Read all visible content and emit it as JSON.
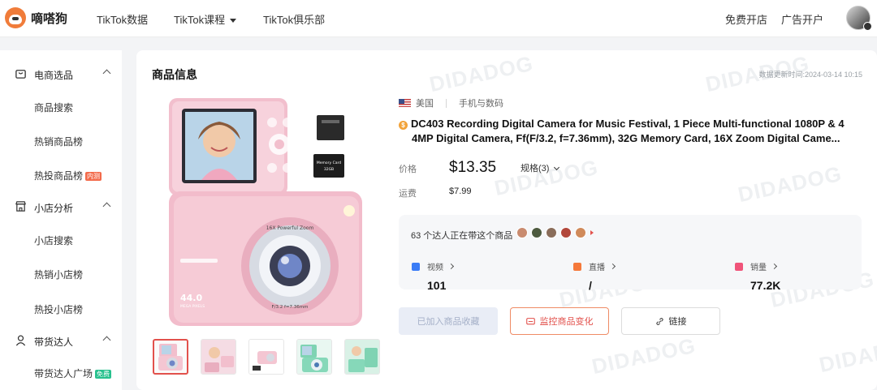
{
  "brand": {
    "name": "嘀嗒狗"
  },
  "nav": {
    "items": [
      "TikTok数据",
      "TikTok课程",
      "TikTok俱乐部"
    ],
    "right": [
      "免费开店",
      "广告开户"
    ]
  },
  "sidebar": {
    "groups": [
      {
        "label": "电商选品",
        "icon": "shopping-bag-icon",
        "items": [
          {
            "label": "商品搜索"
          },
          {
            "label": "热销商品榜"
          },
          {
            "label": "热投商品榜",
            "tag": "内测"
          }
        ]
      },
      {
        "label": "小店分析",
        "icon": "store-icon",
        "items": [
          {
            "label": "小店搜索"
          },
          {
            "label": "热销小店榜"
          },
          {
            "label": "热投小店榜"
          }
        ]
      },
      {
        "label": "带货达人",
        "icon": "person-icon",
        "items": [
          {
            "label": "带货达人广场",
            "tag": "免费"
          }
        ]
      }
    ]
  },
  "watermark": "DIDADOG",
  "product": {
    "section_title": "商品信息",
    "update_time": "数据更新时间:2024-03-14 10:15",
    "region": "美国",
    "category": "手机与数码",
    "title_line1": "DC403 Recording Digital Camera for Music Festival, 1 Piece Multi-functional 1080P & 4",
    "title_line2": "4MP Digital Camera, Ff(F/3.2, f=7.36mm), 32G Memory Card, 16X Zoom Digital Came...",
    "price_label": "价格",
    "price": "$13.35",
    "spec": "规格(3)",
    "shipping_label": "运费",
    "shipping": "$7.99",
    "camera_text": {
      "zoom": "16X Powerful Zoom",
      "mp": "44.0",
      "mp_sub": "MEGA PIXELS",
      "lens": "F/3.2  f=7.36mm",
      "card": "Memory Card",
      "card_size": "32GB"
    }
  },
  "stats": {
    "headline": "63 个达人正在带这个商品",
    "items": [
      {
        "label": "视频",
        "value": "101",
        "color": "#3a7cf6"
      },
      {
        "label": "直播",
        "value": "/",
        "color": "#f5793b"
      },
      {
        "label": "销量",
        "value": "77.2K",
        "color": "#f0547a"
      }
    ]
  },
  "actions": {
    "added": "已加入商品收藏",
    "monitor": "监控商品变化",
    "link": "链接"
  },
  "colors": {
    "accent": "#e2514c",
    "brand": "#f07c3a",
    "camera_pink": "#f4c6d2"
  }
}
